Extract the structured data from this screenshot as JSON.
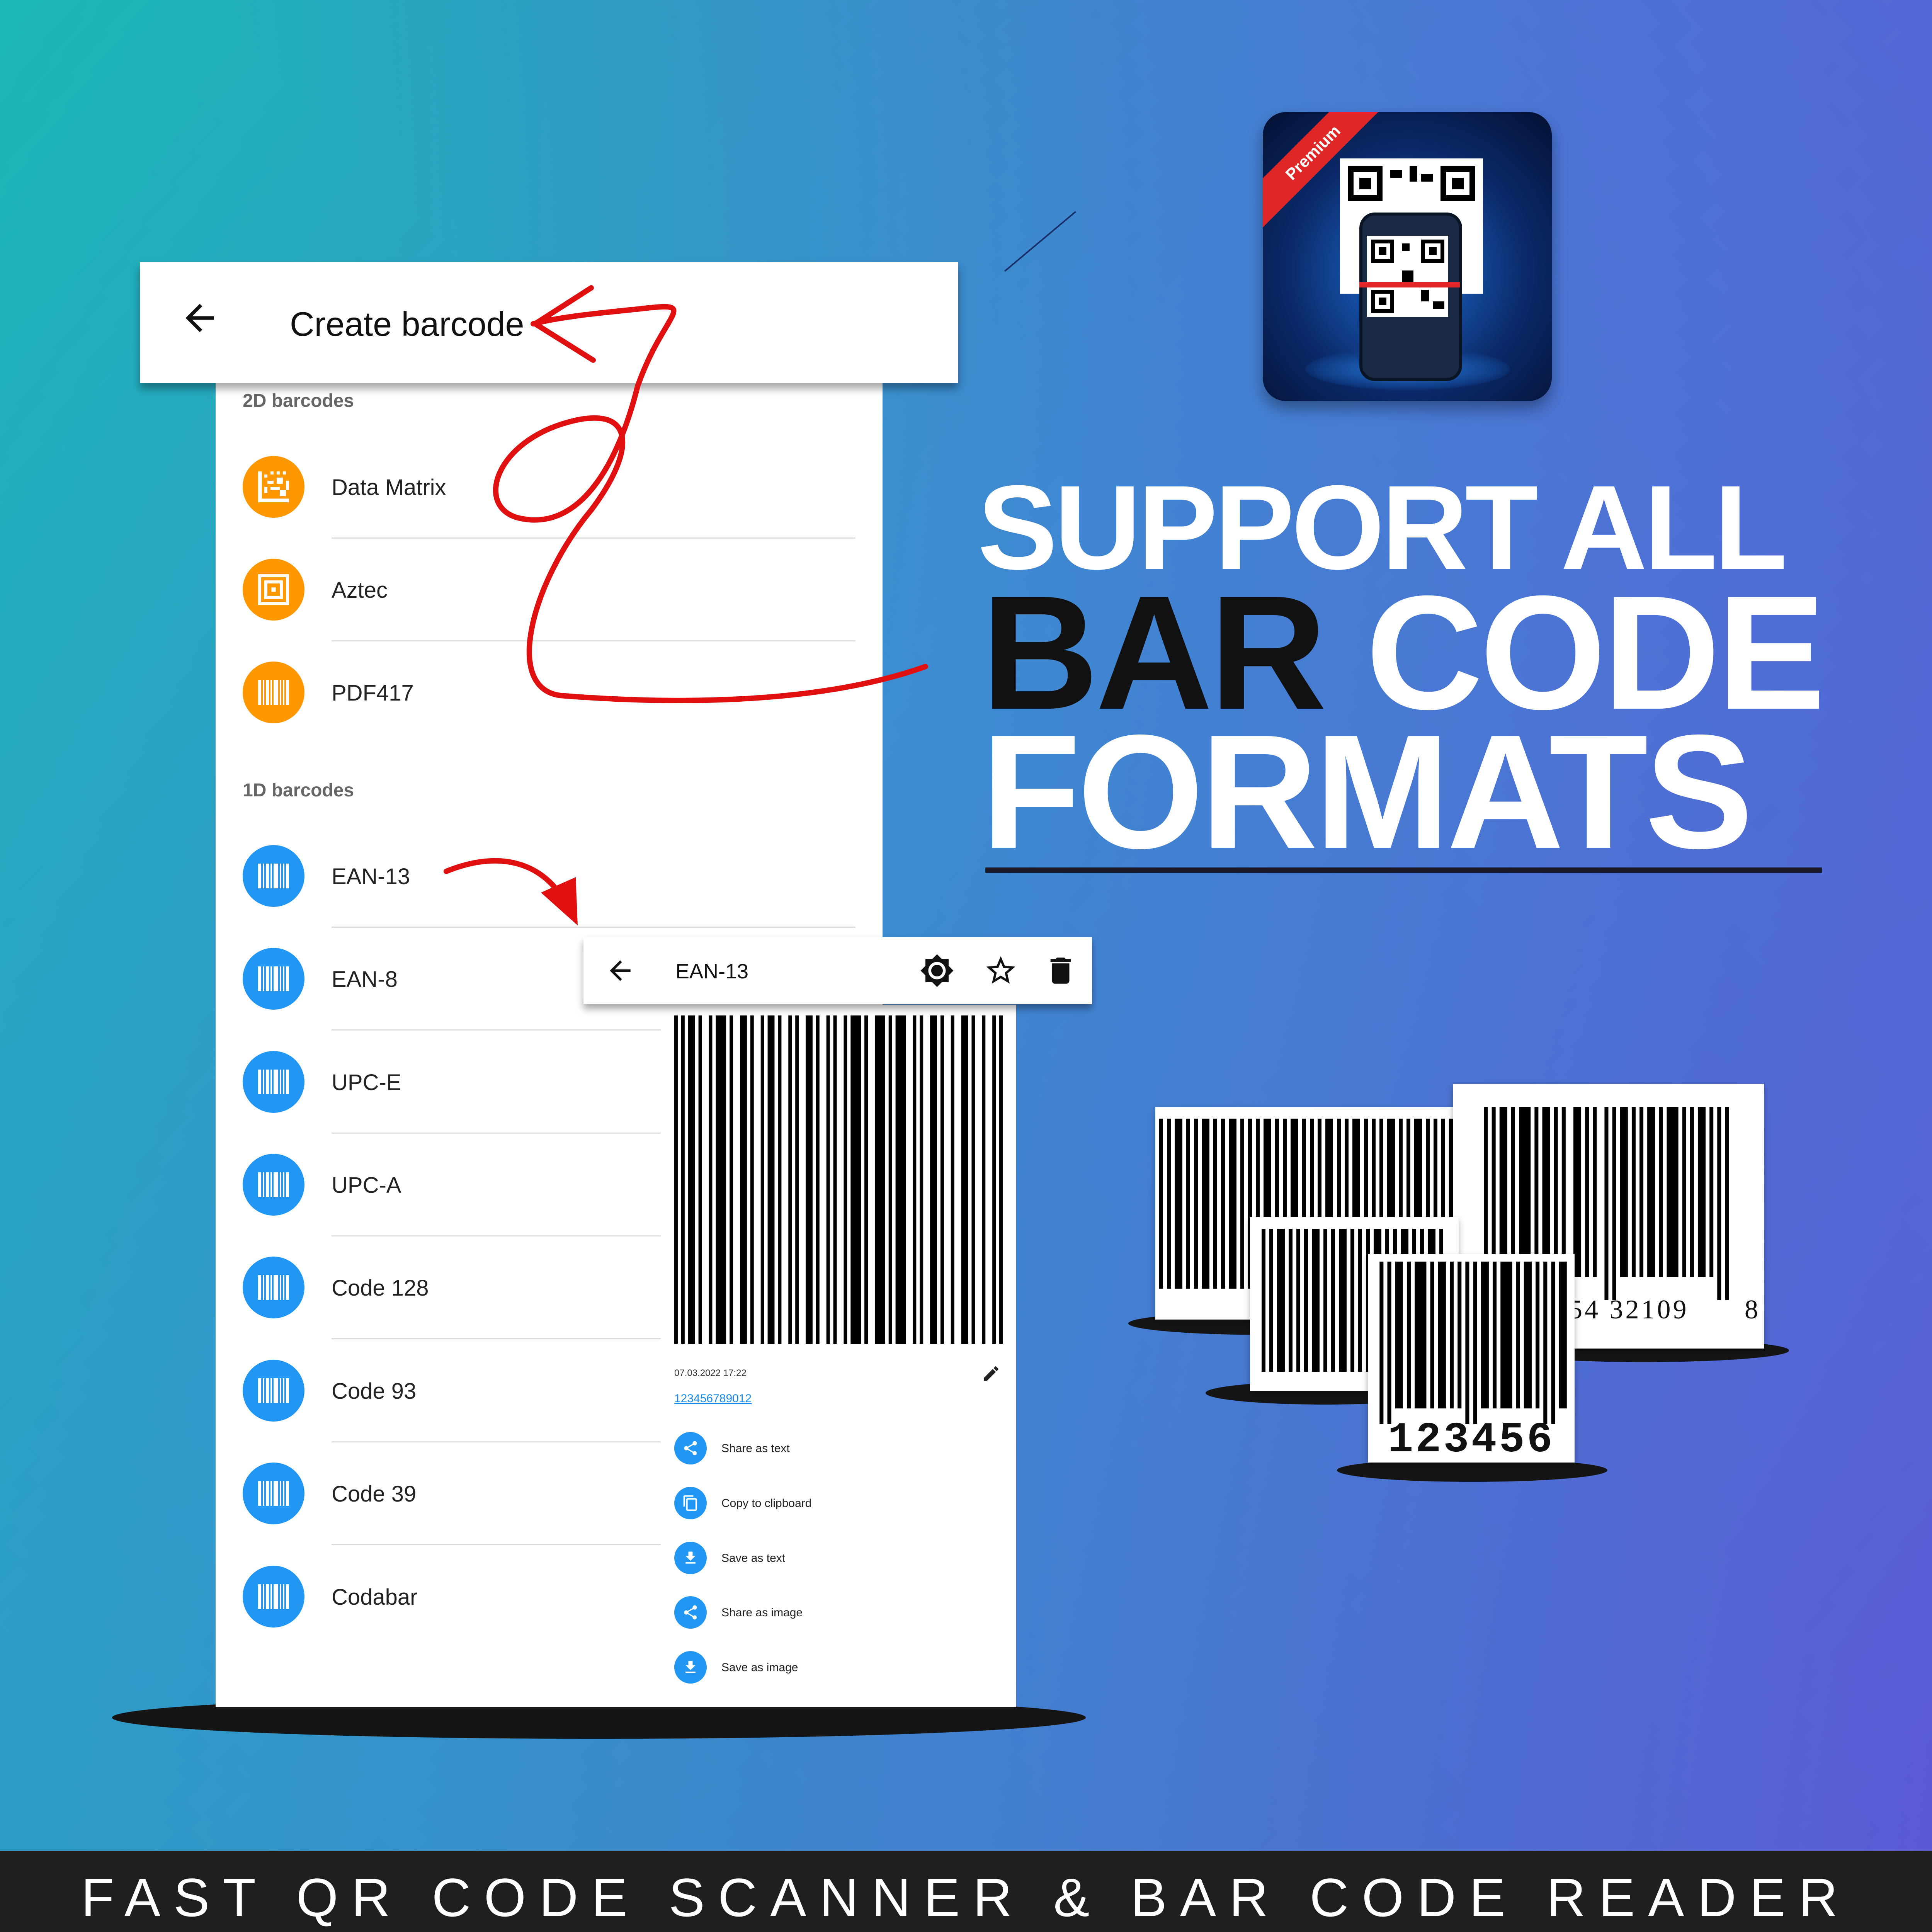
{
  "app_icon": {
    "badge": "Premium",
    "icon": "qr-phone-scanner-icon"
  },
  "headline": {
    "line1": "SUPPORT ALL",
    "line2_dark": "BAR",
    "line2_light": "CODE",
    "line3": "FORMATS"
  },
  "create_screen": {
    "title": "Create barcode",
    "back_icon": "arrow-left-icon",
    "sections": [
      {
        "label": "2D barcodes",
        "items": [
          {
            "label": "Data Matrix",
            "icon": "data-matrix-icon",
            "color": "#ff9800"
          },
          {
            "label": "Aztec",
            "icon": "aztec-icon",
            "color": "#ff9800"
          },
          {
            "label": "PDF417",
            "icon": "pdf417-icon",
            "color": "#ff9800"
          }
        ]
      },
      {
        "label": "1D barcodes",
        "items": [
          {
            "label": "EAN-13",
            "icon": "barcode-icon",
            "color": "#2196f3"
          },
          {
            "label": "EAN-8",
            "icon": "barcode-icon",
            "color": "#2196f3"
          },
          {
            "label": "UPC-E",
            "icon": "barcode-icon",
            "color": "#2196f3"
          },
          {
            "label": "UPC-A",
            "icon": "barcode-icon",
            "color": "#2196f3"
          },
          {
            "label": "Code 128",
            "icon": "barcode-icon",
            "color": "#2196f3"
          },
          {
            "label": "Code 93",
            "icon": "barcode-icon",
            "color": "#2196f3"
          },
          {
            "label": "Code 39",
            "icon": "barcode-icon",
            "color": "#2196f3"
          },
          {
            "label": "Codabar",
            "icon": "barcode-icon",
            "color": "#2196f3"
          }
        ]
      }
    ]
  },
  "detail_screen": {
    "title": "EAN-13",
    "date": "07.03.2022 17:22",
    "code": "123456789012",
    "actions": [
      {
        "label": "Share as text",
        "icon": "share-icon"
      },
      {
        "label": "Copy to clipboard",
        "icon": "copy-icon"
      },
      {
        "label": "Save as text",
        "icon": "download-icon"
      },
      {
        "label": "Share as image",
        "icon": "share-icon"
      },
      {
        "label": "Save as image",
        "icon": "download-icon"
      }
    ]
  },
  "illustration": {
    "front_digits": "123456",
    "back_digits": "54 32109",
    "back_check_digit": "8"
  },
  "footer": {
    "text": "FAST QR CODE SCANNER & BAR CODE READER"
  },
  "colors": {
    "orange": "#ff9800",
    "blue": "#2196f3",
    "annotation_red": "#e01010",
    "footer_bg": "#1f1f1f"
  }
}
